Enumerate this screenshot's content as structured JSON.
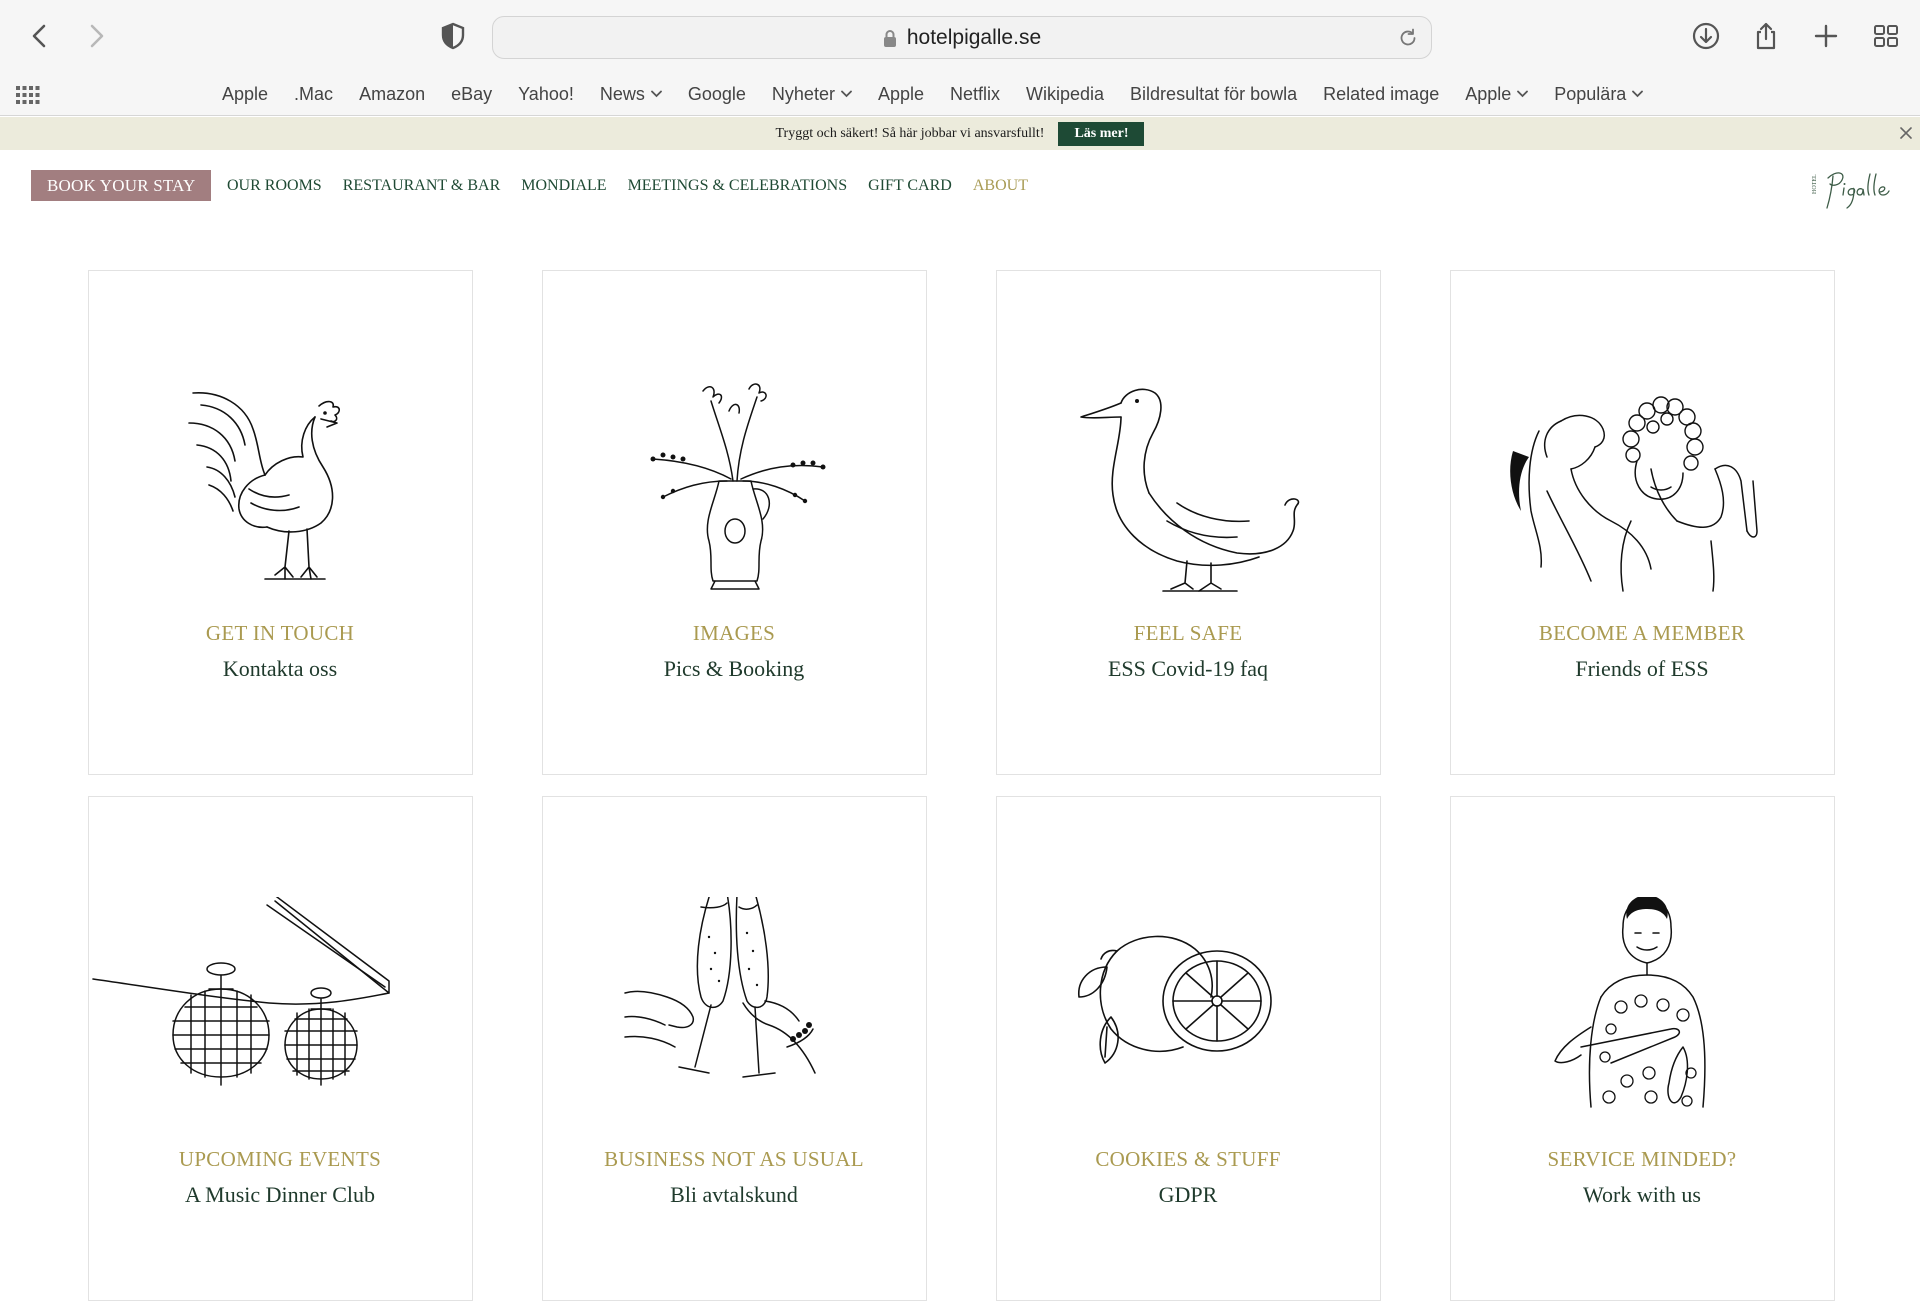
{
  "browser": {
    "url": "hotelpigalle.se",
    "favorites": [
      {
        "label": "Apple",
        "dropdown": false
      },
      {
        "label": ".Mac",
        "dropdown": false
      },
      {
        "label": "Amazon",
        "dropdown": false
      },
      {
        "label": "eBay",
        "dropdown": false
      },
      {
        "label": "Yahoo!",
        "dropdown": false
      },
      {
        "label": "News",
        "dropdown": true
      },
      {
        "label": "Google",
        "dropdown": false
      },
      {
        "label": "Nyheter",
        "dropdown": true
      },
      {
        "label": "Apple",
        "dropdown": false
      },
      {
        "label": "Netflix",
        "dropdown": false
      },
      {
        "label": "Wikipedia",
        "dropdown": false
      },
      {
        "label": "Bildresultat för bowla",
        "dropdown": false
      },
      {
        "label": "Related image",
        "dropdown": false
      },
      {
        "label": "Apple",
        "dropdown": true
      },
      {
        "label": "Populära",
        "dropdown": true
      }
    ]
  },
  "banner": {
    "text": "Tryggt och säkert! Så här jobbar vi ansvarsfullt!",
    "button": "Läs mer!"
  },
  "nav": {
    "book": "BOOK YOUR STAY",
    "links": [
      {
        "label": "OUR ROOMS",
        "active": false
      },
      {
        "label": "RESTAURANT & BAR",
        "active": false
      },
      {
        "label": "MONDIALE",
        "active": false
      },
      {
        "label": "MEETINGS & CELEBRATIONS",
        "active": false
      },
      {
        "label": "GIFT CARD",
        "active": false
      },
      {
        "label": "ABOUT",
        "active": true
      }
    ]
  },
  "cards": [
    {
      "title": "GET IN TOUCH",
      "subtitle": "Kontakta oss",
      "icon": "rooster-icon"
    },
    {
      "title": "IMAGES",
      "subtitle": "Pics & Booking",
      "icon": "flower-vase-icon"
    },
    {
      "title": "FEEL SAFE",
      "subtitle": "ESS Covid-19 faq",
      "icon": "duck-icon"
    },
    {
      "title": "BECOME A MEMBER",
      "subtitle": "Friends of ESS",
      "icon": "friends-icon"
    },
    {
      "title": "UPCOMING EVENTS",
      "subtitle": "A Music Dinner Club",
      "icon": "lanterns-icon"
    },
    {
      "title": "BUSINESS NOT AS USUAL",
      "subtitle": "Bli avtalskund",
      "icon": "champagne-toast-icon"
    },
    {
      "title": "COOKIES & STUFF",
      "subtitle": "GDPR",
      "icon": "lemon-icon"
    },
    {
      "title": "SERVICE MINDED?",
      "subtitle": "Work with us",
      "icon": "waitress-icon"
    }
  ],
  "colors": {
    "book_button": "#a27e80",
    "nav_text": "#1f4a34",
    "accent_gold": "#aa9a50",
    "banner_bg": "#ecebdc",
    "banner_button": "#1e4a35"
  }
}
